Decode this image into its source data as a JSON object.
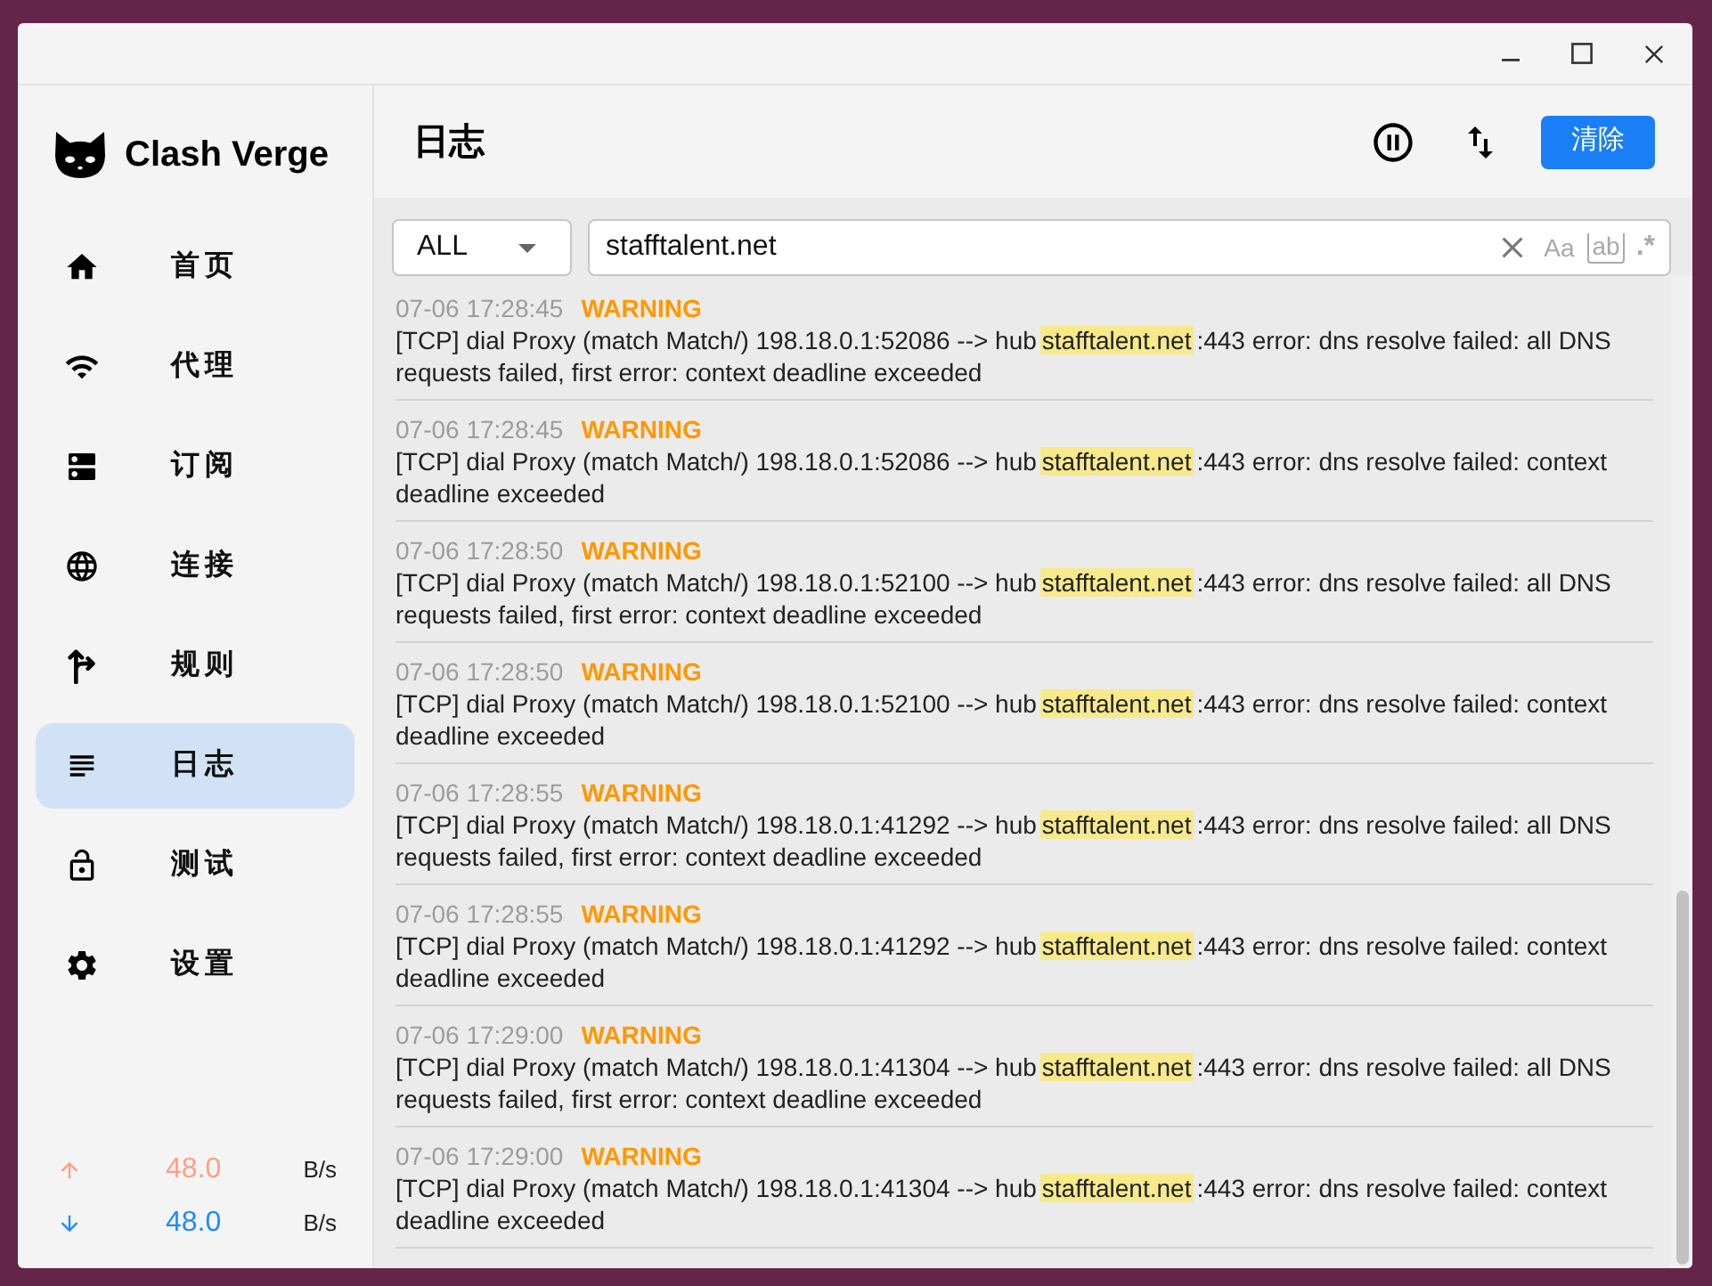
{
  "app": {
    "name": "Clash Verge"
  },
  "nav": {
    "items": [
      {
        "label": "首页",
        "selected": false
      },
      {
        "label": "代理",
        "selected": false
      },
      {
        "label": "订阅",
        "selected": false
      },
      {
        "label": "连接",
        "selected": false
      },
      {
        "label": "规则",
        "selected": false
      },
      {
        "label": "日志",
        "selected": true
      },
      {
        "label": "测试",
        "selected": false
      },
      {
        "label": "设置",
        "selected": false
      }
    ]
  },
  "traffic": {
    "upload": {
      "value": "48.0",
      "unit": "B/s"
    },
    "download": {
      "value": "48.0",
      "unit": "B/s"
    }
  },
  "header": {
    "title": "日志",
    "clear_button": "清除"
  },
  "filter": {
    "level": "ALL",
    "search": {
      "value": "stafftalent.net",
      "options": [
        {
          "kind": "case",
          "label": "Aa"
        },
        {
          "kind": "word",
          "label": "ab"
        },
        {
          "kind": "regex",
          "label": ".*"
        }
      ]
    }
  },
  "logs": [
    {
      "time": "07-06 17:28:45",
      "kind": "warning",
      "level": "WARNING",
      "before": "[TCP] dial Proxy (match Match/) 198.18.0.1:52086 --> hub",
      "match": "stafftalent.net",
      "after": ":443 error: dns resolve failed: all DNS requests failed, first error: context deadline exceeded"
    },
    {
      "time": "07-06 17:28:45",
      "kind": "warning",
      "level": "WARNING",
      "before": "[TCP] dial Proxy (match Match/) 198.18.0.1:52086 --> hub",
      "match": "stafftalent.net",
      "after": ":443 error: dns resolve failed: context deadline exceeded"
    },
    {
      "time": "07-06 17:28:50",
      "kind": "warning",
      "level": "WARNING",
      "before": "[TCP] dial Proxy (match Match/) 198.18.0.1:52100 --> hub",
      "match": "stafftalent.net",
      "after": ":443 error: dns resolve failed: all DNS requests failed, first error: context deadline exceeded"
    },
    {
      "time": "07-06 17:28:50",
      "kind": "warning",
      "level": "WARNING",
      "before": "[TCP] dial Proxy (match Match/) 198.18.0.1:52100 --> hub",
      "match": "stafftalent.net",
      "after": ":443 error: dns resolve failed: context deadline exceeded"
    },
    {
      "time": "07-06 17:28:55",
      "kind": "warning",
      "level": "WARNING",
      "before": "[TCP] dial Proxy (match Match/) 198.18.0.1:41292 --> hub",
      "match": "stafftalent.net",
      "after": ":443 error: dns resolve failed: all DNS requests failed, first error: context deadline exceeded"
    },
    {
      "time": "07-06 17:28:55",
      "kind": "warning",
      "level": "WARNING",
      "before": "[TCP] dial Proxy (match Match/) 198.18.0.1:41292 --> hub",
      "match": "stafftalent.net",
      "after": ":443 error: dns resolve failed: context deadline exceeded"
    },
    {
      "time": "07-06 17:29:00",
      "kind": "warning",
      "level": "WARNING",
      "before": "[TCP] dial Proxy (match Match/) 198.18.0.1:41304 --> hub",
      "match": "stafftalent.net",
      "after": ":443 error: dns resolve failed: all DNS requests failed, first error: context deadline exceeded"
    },
    {
      "time": "07-06 17:29:00",
      "kind": "warning",
      "level": "WARNING",
      "before": "[TCP] dial Proxy (match Match/) 198.18.0.1:41304 --> hub",
      "match": "stafftalent.net",
      "after": ":443 error: dns resolve failed: context deadline exceeded"
    }
  ]
}
